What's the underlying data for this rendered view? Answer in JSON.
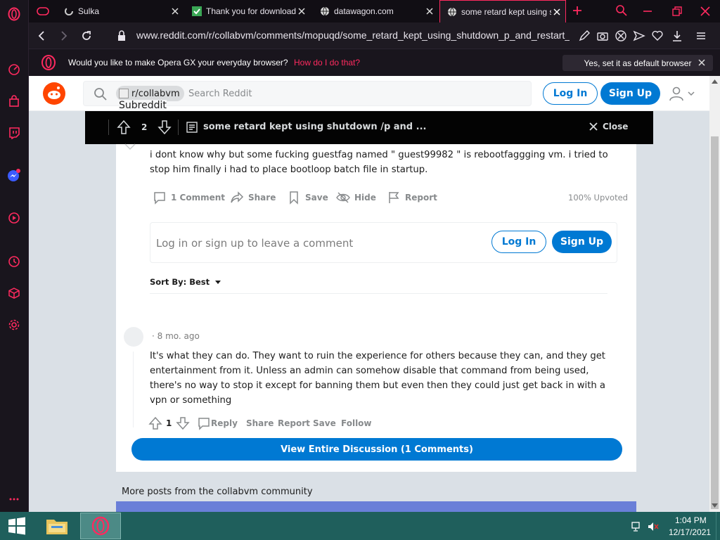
{
  "tabs": [
    {
      "label": "Sulka",
      "icon": "loading-spinner-icon",
      "active": false
    },
    {
      "label": "Thank you for download",
      "icon": "download-page-icon",
      "active": false
    },
    {
      "label": "datawagon.com",
      "icon": "globe-icon",
      "active": false
    },
    {
      "label": "some retard kept using s",
      "icon": "globe-icon",
      "active": true
    }
  ],
  "address_bar": {
    "url": "www.reddit.com/r/collabvm/comments/mopuqd/some_retard_kept_using_shutdown_p_and_restart_"
  },
  "banner": {
    "message": "Would you like to make Opera GX your everyday browser?",
    "link": "How do I do that?",
    "button": "Yes, set it as default browser"
  },
  "reddit": {
    "header": {
      "subreddit_chip": "r/collabvm",
      "broken_image_alt": "Subreddit",
      "search_placeholder": "Search Reddit",
      "login": "Log In",
      "signup": "Sign Up"
    },
    "post_bar": {
      "votes": "2",
      "title": "some retard kept using shutdown /p and ...",
      "close": "Close"
    },
    "post": {
      "body": "i dont know why but some fucking guestfag named \" guest99982 \" is rebootfaggging vm. i tried to stop him finally i had to place bootloop batch file in startup.",
      "actions": {
        "comments": "1 Comment",
        "share": "Share",
        "save": "Save",
        "hide": "Hide",
        "report": "Report"
      },
      "upvoted": "100% Upvoted"
    },
    "comment_box": {
      "prompt": "Log in or sign up to leave a comment",
      "login": "Log In",
      "signup": "Sign Up"
    },
    "sort": {
      "label": "Sort By: Best"
    },
    "comment": {
      "time": "· 8 mo. ago",
      "body": "It's what they can do. They want to ruin the experience for others because they can, and they get entertainment from it. Unless an admin can somehow disable that command from being used, there's no way to stop it except for banning them but even then they could just get back in with a vpn or something",
      "votes": "1",
      "actions": {
        "reply": "Reply",
        "share": "Share",
        "report": "Report",
        "save": "Save",
        "follow": "Follow"
      }
    },
    "view_entire": "View Entire Discussion (1 Comments)",
    "more_posts": "More posts from the collabvm community"
  },
  "taskbar": {
    "time": "1:04 PM",
    "date": "12/17/2021"
  },
  "colors": {
    "opera_accent": "#ff2a5f",
    "reddit_blue": "#0079d3",
    "reddit_orange": "#ff4500",
    "taskbar": "#1f5f5c"
  }
}
